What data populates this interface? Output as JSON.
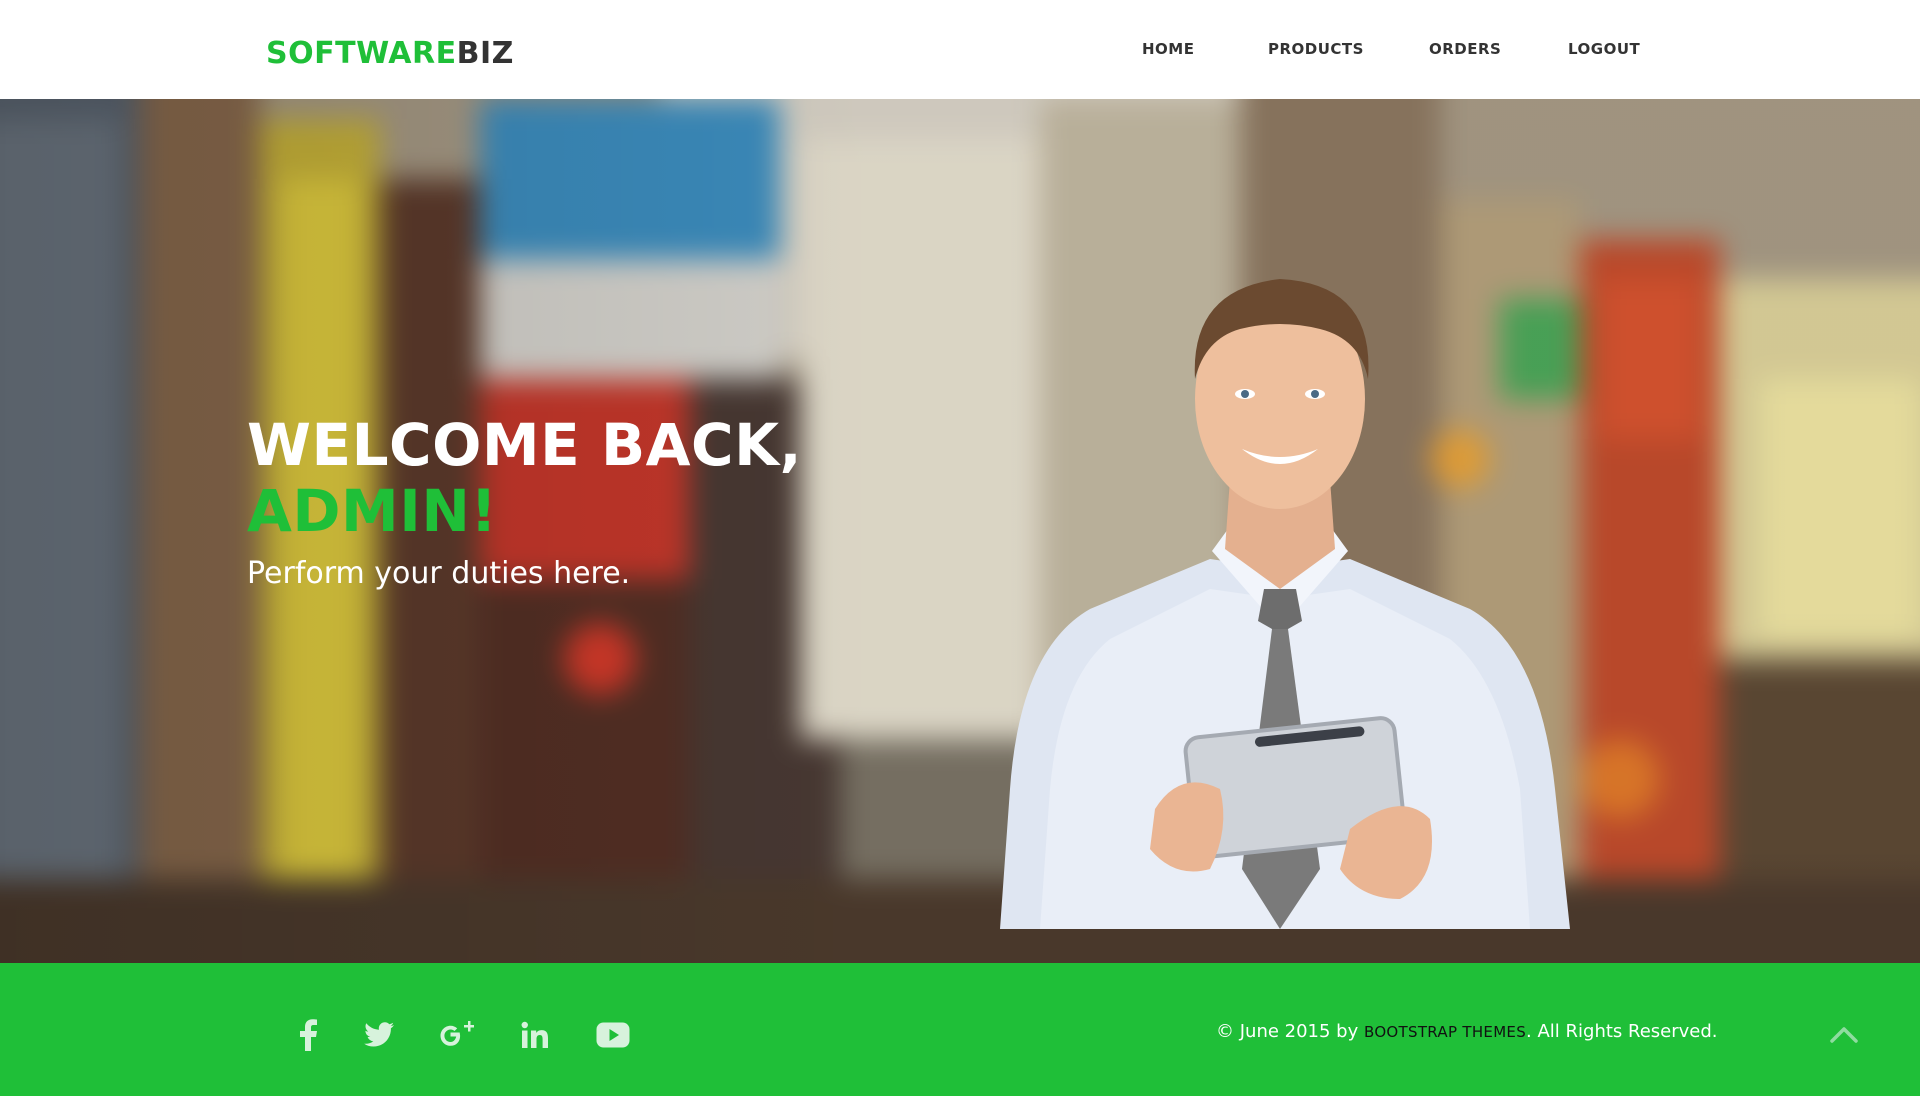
{
  "brand": {
    "name_part1": "SOFTWARE",
    "name_part2": "BIZ",
    "green": "#1fbf38",
    "dark": "#333333"
  },
  "nav": {
    "items": [
      {
        "label": "HOME"
      },
      {
        "label": "PRODUCTS"
      },
      {
        "label": "ORDERS"
      },
      {
        "label": "LOGOUT"
      }
    ]
  },
  "hero": {
    "title": "WELCOME BACK,",
    "title_highlight": "ADMIN!",
    "subtitle": "Perform your duties here."
  },
  "footer": {
    "social": [
      {
        "icon": "facebook-icon"
      },
      {
        "icon": "twitter-icon"
      },
      {
        "icon": "google-plus-icon"
      },
      {
        "icon": "linkedin-icon"
      },
      {
        "icon": "youtube-icon"
      }
    ],
    "copyright_prefix": "© June 2015 by",
    "copyright_link": "BOOTSTRAP THEMES",
    "copyright_suffix": ". All Rights Reserved.",
    "background": "#1fbf38",
    "scroll_top_icon": "chevron-up-icon"
  }
}
